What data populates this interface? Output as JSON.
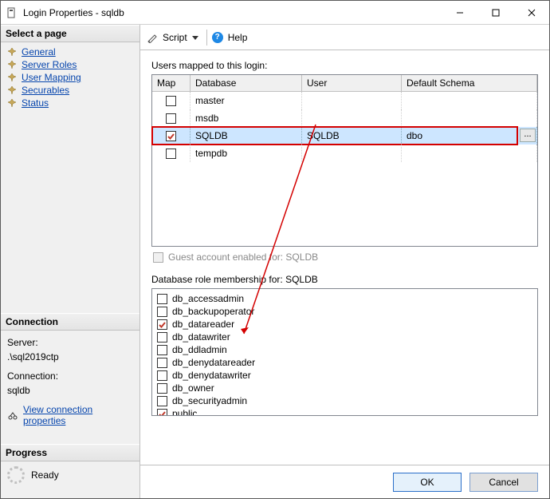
{
  "window": {
    "title": "Login Properties - sqldb"
  },
  "sidebar": {
    "selectPageHeader": "Select a page",
    "items": [
      {
        "label": "General"
      },
      {
        "label": "Server Roles"
      },
      {
        "label": "User Mapping"
      },
      {
        "label": "Securables"
      },
      {
        "label": "Status"
      }
    ],
    "connectionHeader": "Connection",
    "serverLabel": "Server:",
    "serverValue": ".\\sql2019ctp",
    "connectionLabel": "Connection:",
    "connectionValue": "sqldb",
    "viewConnectionProps": "View connection properties",
    "progressHeader": "Progress",
    "progressStatus": "Ready"
  },
  "toolbar": {
    "scriptLabel": "Script",
    "helpLabel": "Help"
  },
  "mapping": {
    "label": "Users mapped to this login:",
    "headers": {
      "map": "Map",
      "database": "Database",
      "user": "User",
      "defaultSchema": "Default Schema"
    },
    "rows": [
      {
        "checked": false,
        "database": "master",
        "user": "",
        "schema": ""
      },
      {
        "checked": false,
        "database": "msdb",
        "user": "",
        "schema": ""
      },
      {
        "checked": true,
        "database": "SQLDB",
        "user": "SQLDB",
        "schema": "dbo",
        "selected": true
      },
      {
        "checked": false,
        "database": "tempdb",
        "user": "",
        "schema": ""
      }
    ],
    "guestLabel": "Guest account enabled for: SQLDB"
  },
  "roles": {
    "label": "Database role membership for: SQLDB",
    "items": [
      {
        "label": "db_accessadmin",
        "checked": false
      },
      {
        "label": "db_backupoperator",
        "checked": false
      },
      {
        "label": "db_datareader",
        "checked": true
      },
      {
        "label": "db_datawriter",
        "checked": false
      },
      {
        "label": "db_ddladmin",
        "checked": false
      },
      {
        "label": "db_denydatareader",
        "checked": false
      },
      {
        "label": "db_denydatawriter",
        "checked": false
      },
      {
        "label": "db_owner",
        "checked": false
      },
      {
        "label": "db_securityadmin",
        "checked": false
      },
      {
        "label": "public",
        "checked": true
      }
    ]
  },
  "footer": {
    "ok": "OK",
    "cancel": "Cancel"
  },
  "ellipsis": "..."
}
